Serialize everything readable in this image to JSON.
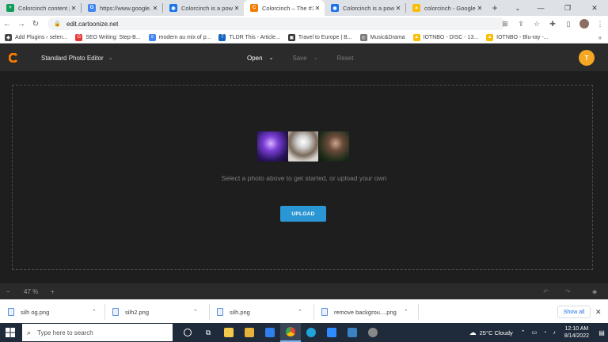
{
  "browser": {
    "tabs": [
      {
        "title": "Colorcinch content pl",
        "favicon": "sheets-icon",
        "color": "#0f9d58",
        "glyph": "+"
      },
      {
        "title": "https://www.google.c",
        "favicon": "google-icon",
        "color": "#4285f4",
        "glyph": "G"
      },
      {
        "title": "Colorcinch is a powe",
        "favicon": "eye-icon",
        "color": "#1a73e8",
        "glyph": "◉"
      },
      {
        "title": "Colorcinch – The #1 P",
        "favicon": "colorcinch-icon",
        "color": "#f57c00",
        "glyph": "C",
        "active": true
      },
      {
        "title": "Colorcinch is a powe",
        "favicon": "eye-icon",
        "color": "#1a73e8",
        "glyph": "◉"
      },
      {
        "title": "colorcinch - Google S",
        "favicon": "drive-icon",
        "color": "#fbbc05",
        "glyph": "▲"
      }
    ],
    "url": "edit.cartoonize.net",
    "bookmarks": [
      {
        "label": "Add Plugins ‹ selen...",
        "color": "#444"
      },
      {
        "label": "SEO Writing: Step-B...",
        "color": "#e53935"
      },
      {
        "label": "modern au mix of p...",
        "color": "#4285f4"
      },
      {
        "label": "TLDR This - Article...",
        "color": "#1565c0"
      },
      {
        "label": "Travel to Europe | B...",
        "color": "#333"
      },
      {
        "label": "Music&Drama",
        "color": "#777"
      },
      {
        "label": "IOTNBO - DISC - 13...",
        "color": "#fbbc05"
      },
      {
        "label": "IOTNBO - Blu-ray -...",
        "color": "#fbbc05"
      }
    ]
  },
  "app": {
    "mode": "Standard Photo Editor",
    "menu": {
      "open": "Open",
      "save": "Save",
      "reset": "Reset"
    },
    "user_initial": "T",
    "hint": "Select a photo above to get started, or upload your own",
    "upload": "UPLOAD",
    "zoom": "47 %"
  },
  "downloads": [
    {
      "name": "silh og.png"
    },
    {
      "name": "silh2.png"
    },
    {
      "name": "silh.png"
    },
    {
      "name": "remove backgrou....png"
    }
  ],
  "downloads_show_all": "Show all",
  "taskbar": {
    "search_placeholder": "Type here to search",
    "weather": "25°C  Cloudy",
    "time": "12:10 AM",
    "date": "8/14/2022"
  }
}
